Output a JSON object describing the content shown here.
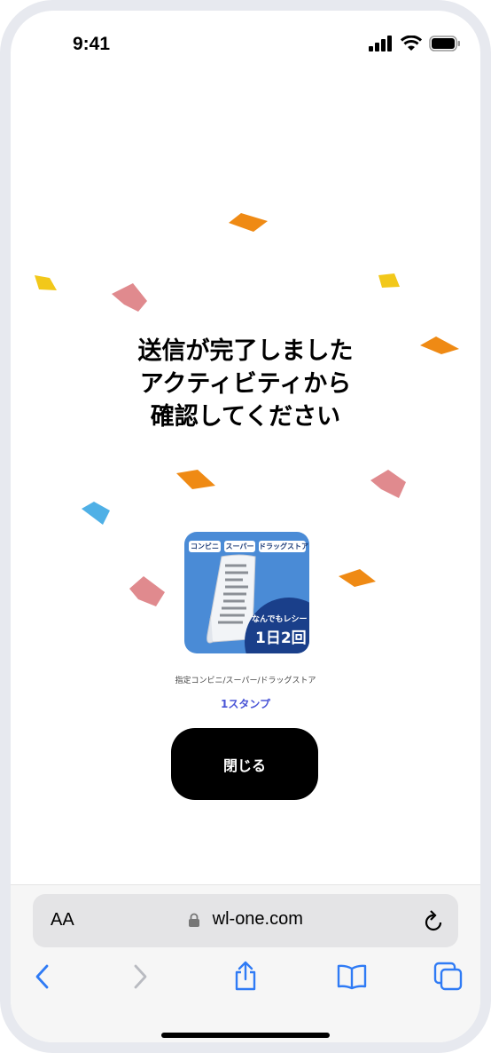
{
  "status_bar": {
    "time": "9:41"
  },
  "message": {
    "line1": "送信が完了しました",
    "line2": "アクティビティから",
    "line3": "確認してください"
  },
  "reward": {
    "tags": [
      "コンビニ",
      "スーパー",
      "ドラッグストア"
    ],
    "badge_small": "なんでもレシート",
    "badge_big": "1日2回",
    "caption": "指定コンビニ/スーパー/ドラッグストア",
    "stamp_label": "1スタンプ"
  },
  "close_button_label": "閉じる",
  "browser": {
    "text_size_label": "AA",
    "url": "wl-one.com"
  },
  "colors": {
    "accent_text": "#4a55d6",
    "confetti_orange": "#ef8a14",
    "confetti_pink": "#e08a8e",
    "confetti_yellow": "#f2c81a",
    "confetti_blue": "#4fb0e6",
    "reward_bg": "#4a8bd6",
    "safari_blue": "#2f7bf5"
  },
  "icons": [
    "signal-icon",
    "wifi-icon",
    "battery-icon",
    "lock-icon",
    "reload-icon",
    "back-icon",
    "forward-icon",
    "share-icon",
    "bookmarks-icon",
    "tabs-icon"
  ]
}
